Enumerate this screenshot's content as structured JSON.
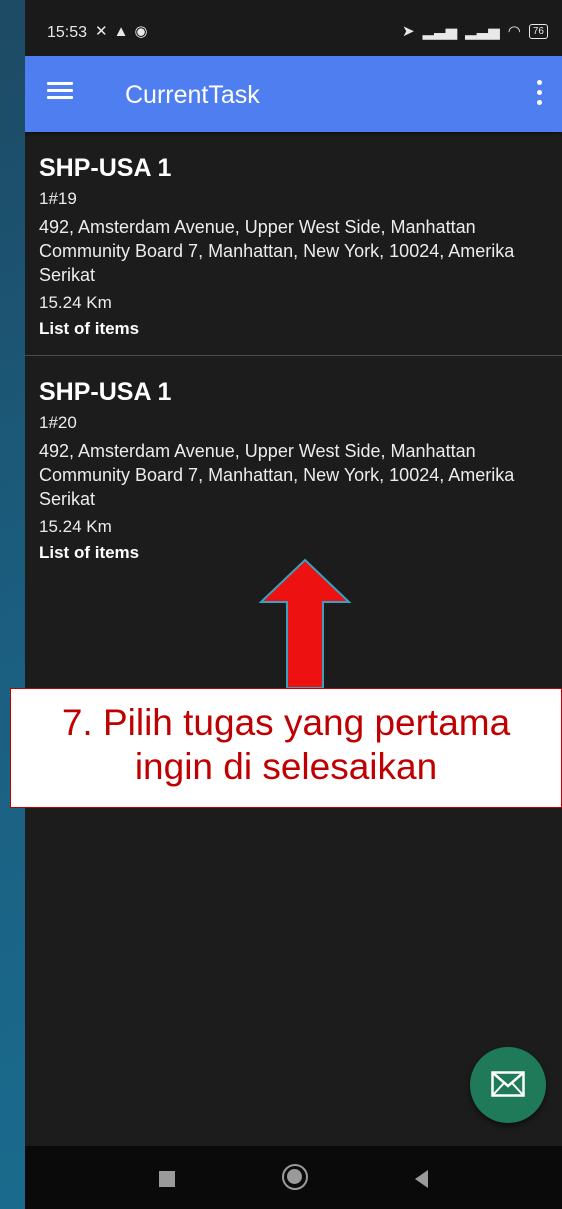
{
  "status_bar": {
    "time": "15:53",
    "left_icons": [
      "mute-icon",
      "navigation-icon",
      "location-icon"
    ],
    "right_icons": [
      "location-arrow-icon",
      "signal-icon",
      "signal-icon",
      "wifi-icon"
    ],
    "battery": "76"
  },
  "app_bar": {
    "title": "CurrentTask",
    "menu_icon": "hamburger-menu-icon",
    "overflow_icon": "more-vert-icon",
    "color": "#4f7ef0"
  },
  "tasks": [
    {
      "name": "SHP-USA 1",
      "code": "1#19",
      "address": "492, Amsterdam Avenue, Upper West Side, Manhattan Community Board 7, Manhattan, New York, 10024, Amerika Serikat",
      "distance": "15.24 Km",
      "items_label": "List of items"
    },
    {
      "name": "SHP-USA 1",
      "code": "1#20",
      "address": "492, Amsterdam Avenue, Upper West Side, Manhattan Community Board 7, Manhattan, New York, 10024, Amerika Serikat",
      "distance": "15.24 Km",
      "items_label": "List of items"
    }
  ],
  "annotation": {
    "line1": "7. Pilih tugas yang pertama",
    "line2": "ingin di selesaikan",
    "color": "#c00000"
  },
  "fab": {
    "icon": "mail-icon",
    "color": "#1f7a5a"
  },
  "nav_bar": {
    "icons": [
      "back-square-icon",
      "home-circle-icon",
      "recent-triangle-icon"
    ]
  }
}
